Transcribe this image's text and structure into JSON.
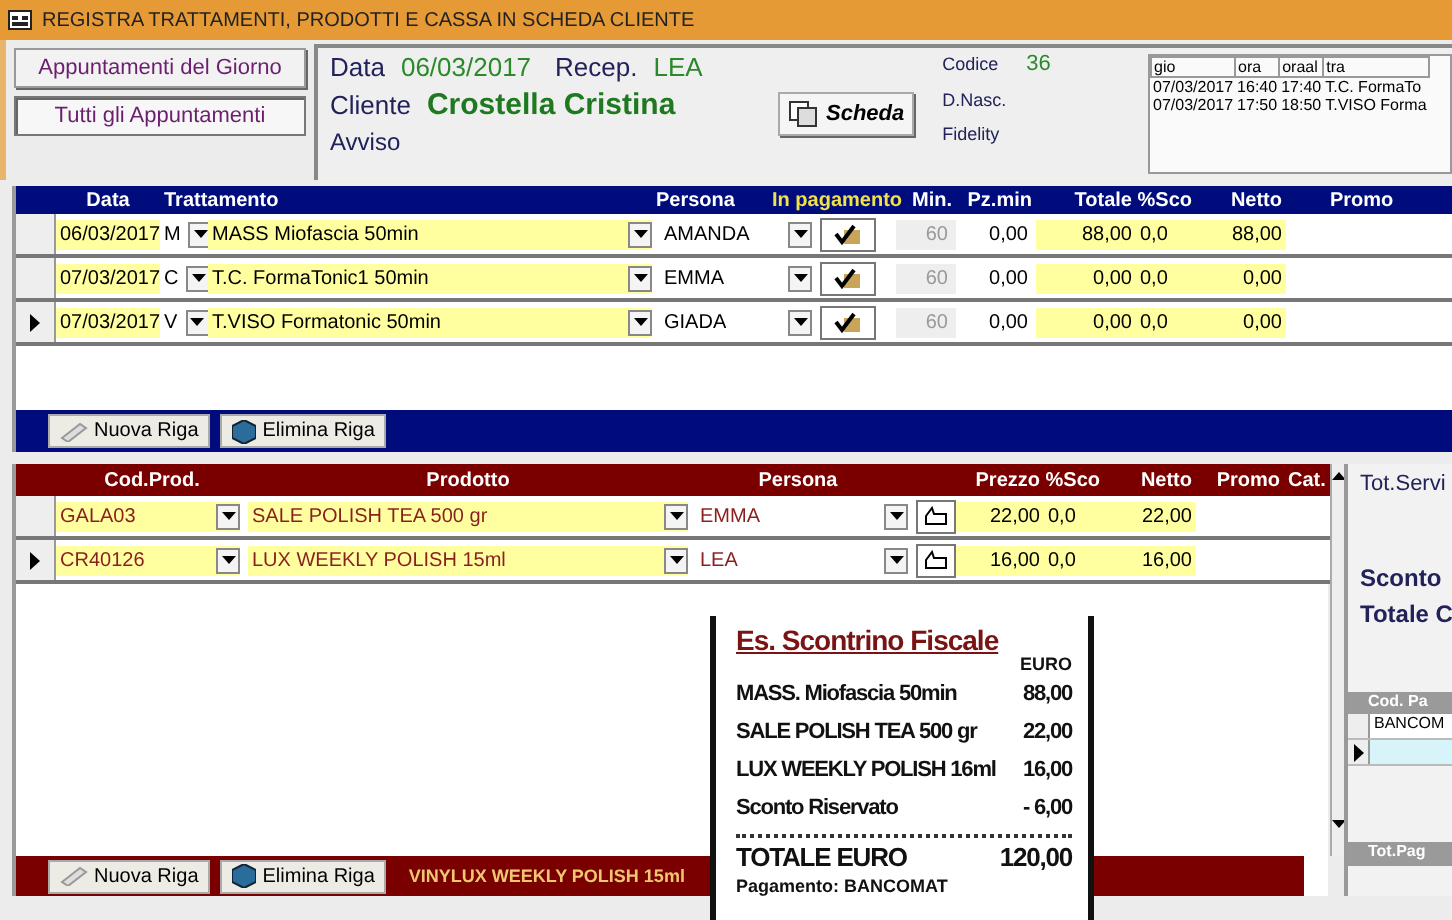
{
  "window": {
    "title": "REGISTRA TRATTAMENTI, PRODOTTI E CASSA IN SCHEDA CLIENTE"
  },
  "nav_buttons": [
    {
      "label": "Appuntamenti del Giorno",
      "selected": false
    },
    {
      "label": "Tutti gli Appuntamenti",
      "selected": true
    }
  ],
  "header": {
    "data_label": "Data",
    "data": "06/03/2017",
    "recep_label": "Recep.",
    "recep": "LEA",
    "cliente_label": "Cliente",
    "cliente": "Crostella Cristina",
    "avviso_label": "Avviso",
    "scheda_button": "Scheda",
    "codice_label": "Codice",
    "codice": "36",
    "dnasc_label": "D.Nasc.",
    "fidelity_label": "Fidelity"
  },
  "appointments": {
    "columns": [
      "gio",
      "ora",
      "oraal",
      "tra"
    ],
    "rows": [
      [
        "07/03/2017",
        "16:40",
        "17:40",
        "T.C. FormaTo"
      ],
      [
        "07/03/2017",
        "17:50",
        "18:50",
        "T.VISO Forma"
      ]
    ]
  },
  "treatments": {
    "columns": [
      "Data",
      "Trattamento",
      "Persona",
      "In pagamento",
      "Min.",
      "Pz.min",
      "Totale",
      "%Sco",
      "Netto",
      "Promo"
    ],
    "rows": [
      {
        "data": "06/03/2017",
        "code": "M",
        "trattamento": "MASS Miofascia 50min",
        "persona": "AMANDA",
        "paid": true,
        "min": "60",
        "pzmin": "0,00",
        "totale": "88,00",
        "sco": "0,0",
        "netto": "88,00",
        "selected": false
      },
      {
        "data": "07/03/2017",
        "code": "C",
        "trattamento": "T.C. FormaTonic1 50min",
        "persona": "EMMA",
        "paid": true,
        "min": "60",
        "pzmin": "0,00",
        "totale": "0,00",
        "sco": "0,0",
        "netto": "0,00",
        "selected": false
      },
      {
        "data": "07/03/2017",
        "code": "V",
        "trattamento": "T.VISO Formatonic 50min",
        "persona": "GIADA",
        "paid": true,
        "min": "60",
        "pzmin": "0,00",
        "totale": "0,00",
        "sco": "0,0",
        "netto": "0,00",
        "selected": true
      }
    ],
    "buttons": [
      "Nuova Riga",
      "Elimina Riga"
    ]
  },
  "products": {
    "columns": [
      "Cod.Prod.",
      "Prodotto",
      "Persona",
      "Prezzo",
      "%Sco",
      "Netto",
      "Promo",
      "Cat."
    ],
    "rows": [
      {
        "cod": "GALA03",
        "prodotto": "SALE POLISH TEA 500 gr",
        "persona": "EMMA",
        "prezzo": "22,00",
        "sco": "0,0",
        "netto": "22,00",
        "selected": false
      },
      {
        "cod": "CR40126",
        "prodotto": "LUX WEEKLY POLISH 15ml",
        "persona": "LEA",
        "prezzo": "16,00",
        "sco": "0,0",
        "netto": "16,00",
        "selected": true
      }
    ],
    "buttons": [
      "Nuova Riga",
      "Elimina Riga"
    ],
    "status": "VINYLUX WEEKLY POLISH 15ml"
  },
  "totals": {
    "tot_servizi": "Tot.Servi",
    "sconto": "Sconto",
    "totale": "Totale C"
  },
  "payments": {
    "column": "Cod. Pa",
    "rows": [
      {
        "code": "BANCOM",
        "selected": false
      },
      {
        "selected": true
      }
    ],
    "footer": "Tot.Pag"
  },
  "receipt": {
    "title": "Es. Scontrino Fiscale",
    "currency": "EURO",
    "lines": [
      {
        "label": "MASS. Miofascia 50min",
        "amount": "88,00"
      },
      {
        "label": "SALE POLISH TEA 500 gr",
        "amount": "22,00"
      },
      {
        "label": "LUX WEEKLY POLISH 16ml",
        "amount": "16,00"
      },
      {
        "label": "Sconto Riservato",
        "amount": "- 6,00"
      }
    ],
    "total_label": "TOTALE EURO",
    "total": "120,00",
    "payment": "Pagamento: BANCOMAT"
  }
}
